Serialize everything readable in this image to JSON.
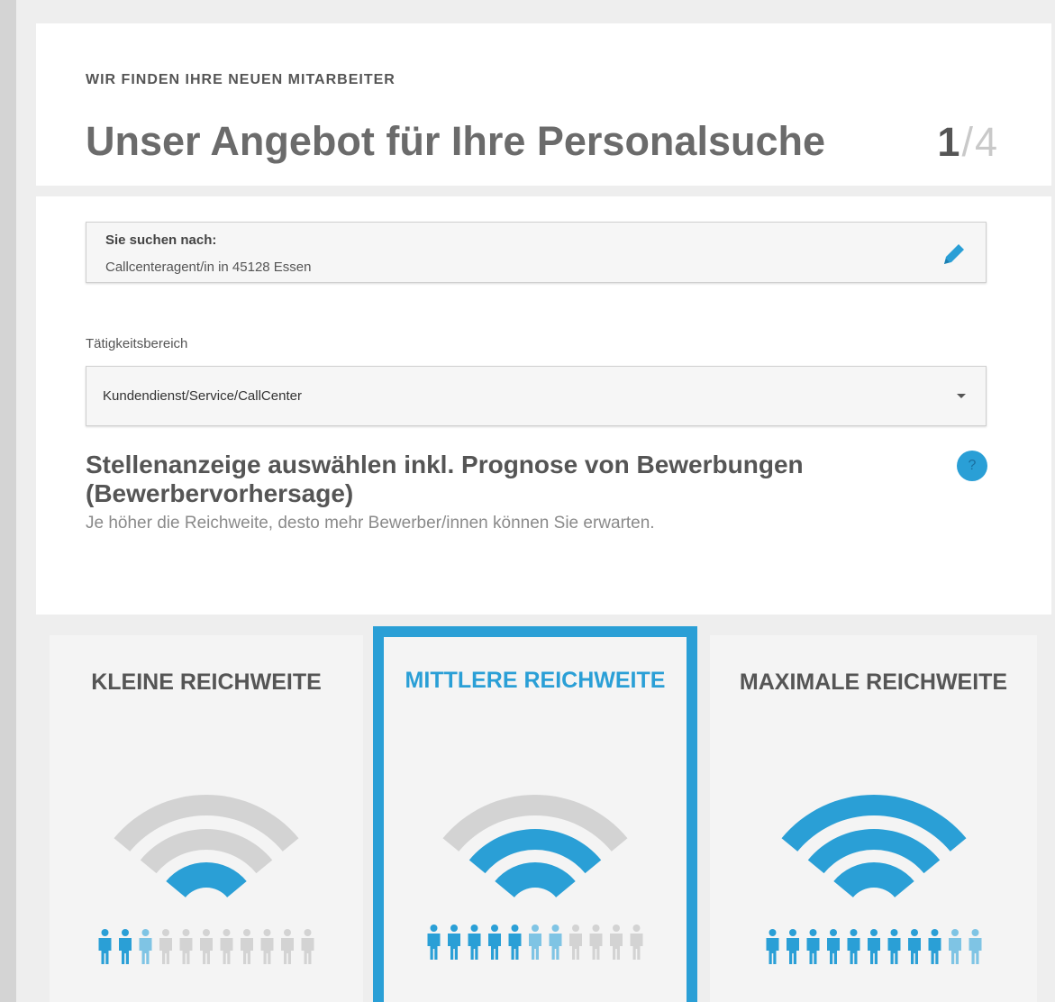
{
  "header": {
    "eyebrow": "WIR FINDEN IHRE NEUEN MITARBEITER",
    "title": "Unser Angebot für Ihre Personalsuche",
    "step_current": "1",
    "step_separator": "/",
    "step_total": "4"
  },
  "search": {
    "label": "Sie suchen nach:",
    "value": "Callcenteragent/in in 45128 Essen",
    "edit_icon": "pencil-icon"
  },
  "category": {
    "label": "Tätigkeitsbereich",
    "value": "Kundendienst/Service/CallCenter"
  },
  "selection": {
    "heading": "Stellenanzeige auswählen inkl. Prognose von Bewerbungen (Bewerbervorhersage)",
    "subtext": "Je höher die Reichweite, desto mehr Bewerber/innen können Sie erwarten.",
    "help_icon": "question-icon",
    "help_glyph": "?"
  },
  "reach_options": [
    {
      "title": "KLEINE REICHWEITE",
      "arcs_active": 1,
      "people_dark": 2,
      "people_light": 1,
      "people_total": 11,
      "selected": false
    },
    {
      "title": "MITTLERE REICHWEITE",
      "arcs_active": 2,
      "people_dark": 5,
      "people_light": 2,
      "people_total": 11,
      "selected": true
    },
    {
      "title": "MAXIMALE REICHWEITE",
      "arcs_active": 3,
      "people_dark": 9,
      "people_light": 2,
      "people_total": 11,
      "selected": false
    }
  ],
  "colors": {
    "accent": "#2a9fd6",
    "accent_light": "#7fc4e4",
    "inactive": "#d3d3d3"
  }
}
